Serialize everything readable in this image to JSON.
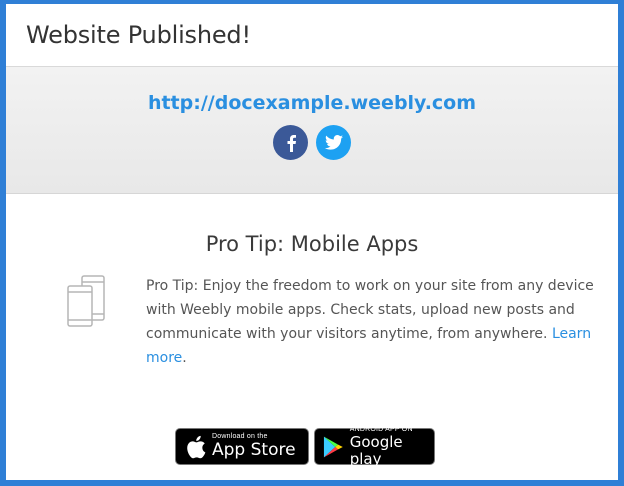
{
  "dialog": {
    "title": "Website Published!"
  },
  "published": {
    "url": "http://docexample.weebly.com",
    "social": [
      {
        "name": "facebook",
        "icon": "facebook-icon",
        "color": "#3b5998"
      },
      {
        "name": "twitter",
        "icon": "twitter-icon",
        "color": "#1da1f2"
      }
    ]
  },
  "tip": {
    "heading": "Pro Tip: Mobile Apps",
    "body": "Pro Tip: Enjoy the freedom to work on your site from any device with Weebly mobile apps. Check stats, upload new posts and communicate with your visitors anytime, from anywhere.",
    "link": "Learn more",
    "period": ".",
    "icon": "mobile-devices-icon"
  },
  "stores": {
    "apple": {
      "small": "Download on the",
      "big": "App Store",
      "icon": "apple-icon"
    },
    "google": {
      "small": "ANDROID APP ON",
      "big": "Google play",
      "icon": "google-play-icon"
    }
  },
  "colors": {
    "accent": "#2a8fe0",
    "frame": "#2f7fd6"
  }
}
